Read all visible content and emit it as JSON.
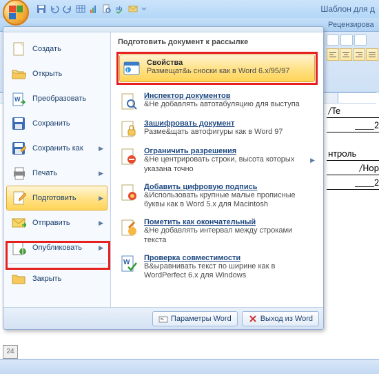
{
  "window": {
    "title": "Шаблон для д"
  },
  "tabs": {
    "visible": "Рецензирова"
  },
  "office_menu": {
    "left": [
      {
        "label": "Создать",
        "icon": "new"
      },
      {
        "label": "Открыть",
        "icon": "open"
      },
      {
        "label": "Преобразовать",
        "icon": "convert"
      },
      {
        "label": "Сохранить",
        "icon": "save"
      },
      {
        "label": "Сохранить как",
        "icon": "saveas",
        "arrow": true
      },
      {
        "label": "Печать",
        "icon": "print",
        "arrow": true
      },
      {
        "label": "Подготовить",
        "icon": "prepare",
        "arrow": true,
        "highlight": true
      },
      {
        "label": "Отправить",
        "icon": "send",
        "arrow": true
      },
      {
        "label": "Опубликовать",
        "icon": "publish",
        "arrow": true
      },
      {
        "label": "Закрыть",
        "icon": "close"
      }
    ],
    "right_title": "Подготовить документ к рассылке",
    "right": [
      {
        "title": "Свойства",
        "desc": "Размещат&ь сноски как в Word 6.x/95/97",
        "icon": "properties",
        "highlight": true,
        "boxed": true
      },
      {
        "title": "Инспектор документов",
        "desc": "&Не добавлять автотабуляцию для выступа",
        "icon": "inspect"
      },
      {
        "title": "Зашифровать документ",
        "desc": "Разме&щать автофигуры как в Word 97",
        "icon": "encrypt"
      },
      {
        "title": "Ограничить разрешения",
        "desc": "&Не центрировать строки, высота которых указана точно",
        "icon": "restrict",
        "arrow": true
      },
      {
        "title": "Добавить цифровую подпись",
        "desc": "&Использовать крупные малые прописные буквы как в Word 5.x для Macintosh",
        "icon": "sign"
      },
      {
        "title": "Пометить как окончательный",
        "desc": "&Не добавлять интервал между строками текста",
        "icon": "final"
      },
      {
        "title": "Проверка совместимости",
        "desc": "В&ыравнивать текст по ширине как в WordPerfect 6.x для Windows",
        "icon": "compat"
      }
    ],
    "buttons": {
      "options": "Параметры Word",
      "exit": "Выход из Word"
    }
  },
  "document": {
    "lines": [
      "/Те",
      "____2",
      "нтроль",
      "/Нор",
      "____2"
    ]
  },
  "status": {
    "page_tab": "24"
  }
}
